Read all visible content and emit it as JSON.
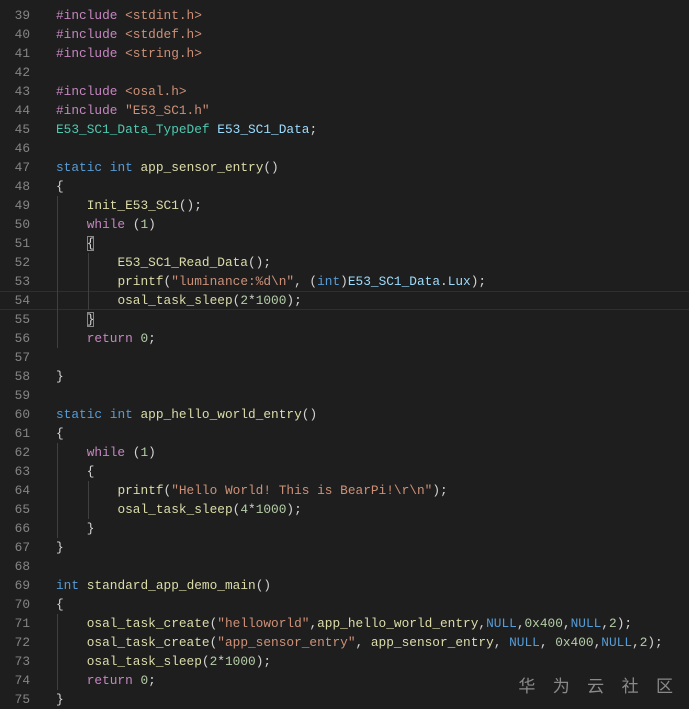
{
  "editor": {
    "current_line": 54,
    "colors": {
      "background": "#1e1e1e",
      "keyword": "#c586c0",
      "string": "#ce9178",
      "type": "#569cd6",
      "function": "#dcdcaa",
      "variable": "#9cdcfe",
      "class": "#4ec9b0",
      "number": "#b5cea8"
    },
    "lines": [
      {
        "n": "39",
        "tokens": [
          [
            "kw",
            "#include"
          ],
          [
            "plain",
            " "
          ],
          [
            "str",
            "<stdint.h>"
          ]
        ]
      },
      {
        "n": "40",
        "tokens": [
          [
            "kw",
            "#include"
          ],
          [
            "plain",
            " "
          ],
          [
            "str",
            "<stddef.h>"
          ]
        ]
      },
      {
        "n": "41",
        "tokens": [
          [
            "kw",
            "#include"
          ],
          [
            "plain",
            " "
          ],
          [
            "str",
            "<string.h>"
          ]
        ]
      },
      {
        "n": "42",
        "tokens": []
      },
      {
        "n": "43",
        "tokens": [
          [
            "kw",
            "#include"
          ],
          [
            "plain",
            " "
          ],
          [
            "str",
            "<osal.h>"
          ]
        ]
      },
      {
        "n": "44",
        "tokens": [
          [
            "kw",
            "#include"
          ],
          [
            "plain",
            " "
          ],
          [
            "str",
            "\"E53_SC1.h\""
          ]
        ]
      },
      {
        "n": "45",
        "tokens": [
          [
            "cls",
            "E53_SC1_Data_TypeDef"
          ],
          [
            "plain",
            " "
          ],
          [
            "var",
            "E53_SC1_Data"
          ],
          [
            "plain",
            ";"
          ]
        ]
      },
      {
        "n": "46",
        "tokens": []
      },
      {
        "n": "47",
        "tokens": [
          [
            "type",
            "static"
          ],
          [
            "plain",
            " "
          ],
          [
            "type",
            "int"
          ],
          [
            "plain",
            " "
          ],
          [
            "fn",
            "app_sensor_entry"
          ],
          [
            "plain",
            "()"
          ]
        ]
      },
      {
        "n": "48",
        "tokens": [
          [
            "plain",
            "{"
          ]
        ]
      },
      {
        "n": "49",
        "tokens": [
          [
            "plain",
            "    "
          ],
          [
            "fn",
            "Init_E53_SC1"
          ],
          [
            "plain",
            "();"
          ]
        ]
      },
      {
        "n": "50",
        "tokens": [
          [
            "plain",
            "    "
          ],
          [
            "kw",
            "while"
          ],
          [
            "plain",
            " ("
          ],
          [
            "num",
            "1"
          ],
          [
            "plain",
            ")"
          ]
        ]
      },
      {
        "n": "51",
        "tokens": [
          [
            "plain",
            "    "
          ],
          [
            "br",
            "{"
          ]
        ]
      },
      {
        "n": "52",
        "tokens": [
          [
            "plain",
            "        "
          ],
          [
            "fn",
            "E53_SC1_Read_Data"
          ],
          [
            "plain",
            "();"
          ]
        ]
      },
      {
        "n": "53",
        "tokens": [
          [
            "plain",
            "        "
          ],
          [
            "fn",
            "printf"
          ],
          [
            "plain",
            "("
          ],
          [
            "str",
            "\"luminance:%d\\n\""
          ],
          [
            "plain",
            ", ("
          ],
          [
            "type",
            "int"
          ],
          [
            "plain",
            ")"
          ],
          [
            "var",
            "E53_SC1_Data"
          ],
          [
            "plain",
            "."
          ],
          [
            "var",
            "Lux"
          ],
          [
            "plain",
            ");"
          ]
        ]
      },
      {
        "n": "54",
        "tokens": [
          [
            "plain",
            "        "
          ],
          [
            "fn",
            "osal_task_sleep"
          ],
          [
            "plain",
            "("
          ],
          [
            "num",
            "2"
          ],
          [
            "plain",
            "*"
          ],
          [
            "num",
            "1000"
          ],
          [
            "plain",
            ");"
          ]
        ]
      },
      {
        "n": "55",
        "tokens": [
          [
            "plain",
            "    "
          ],
          [
            "br",
            "}"
          ]
        ]
      },
      {
        "n": "56",
        "tokens": [
          [
            "plain",
            "    "
          ],
          [
            "kw",
            "return"
          ],
          [
            "plain",
            " "
          ],
          [
            "num",
            "0"
          ],
          [
            "plain",
            ";"
          ]
        ]
      },
      {
        "n": "57",
        "tokens": []
      },
      {
        "n": "58",
        "tokens": [
          [
            "plain",
            "}"
          ]
        ]
      },
      {
        "n": "59",
        "tokens": []
      },
      {
        "n": "60",
        "tokens": [
          [
            "type",
            "static"
          ],
          [
            "plain",
            " "
          ],
          [
            "type",
            "int"
          ],
          [
            "plain",
            " "
          ],
          [
            "fn",
            "app_hello_world_entry"
          ],
          [
            "plain",
            "()"
          ]
        ]
      },
      {
        "n": "61",
        "tokens": [
          [
            "plain",
            "{"
          ]
        ]
      },
      {
        "n": "62",
        "tokens": [
          [
            "plain",
            "    "
          ],
          [
            "kw",
            "while"
          ],
          [
            "plain",
            " ("
          ],
          [
            "num",
            "1"
          ],
          [
            "plain",
            ")"
          ]
        ]
      },
      {
        "n": "63",
        "tokens": [
          [
            "plain",
            "    {"
          ]
        ]
      },
      {
        "n": "64",
        "tokens": [
          [
            "plain",
            "        "
          ],
          [
            "fn",
            "printf"
          ],
          [
            "plain",
            "("
          ],
          [
            "str",
            "\"Hello World! This is BearPi!\\r\\n\""
          ],
          [
            "plain",
            ");"
          ]
        ]
      },
      {
        "n": "65",
        "tokens": [
          [
            "plain",
            "        "
          ],
          [
            "fn",
            "osal_task_sleep"
          ],
          [
            "plain",
            "("
          ],
          [
            "num",
            "4"
          ],
          [
            "plain",
            "*"
          ],
          [
            "num",
            "1000"
          ],
          [
            "plain",
            ");"
          ]
        ]
      },
      {
        "n": "66",
        "tokens": [
          [
            "plain",
            "    }"
          ]
        ]
      },
      {
        "n": "67",
        "tokens": [
          [
            "plain",
            "}"
          ]
        ]
      },
      {
        "n": "68",
        "tokens": []
      },
      {
        "n": "69",
        "tokens": [
          [
            "type",
            "int"
          ],
          [
            "plain",
            " "
          ],
          [
            "fn",
            "standard_app_demo_main"
          ],
          [
            "plain",
            "()"
          ]
        ]
      },
      {
        "n": "70",
        "tokens": [
          [
            "plain",
            "{"
          ]
        ]
      },
      {
        "n": "71",
        "tokens": [
          [
            "plain",
            "    "
          ],
          [
            "fn",
            "osal_task_create"
          ],
          [
            "plain",
            "("
          ],
          [
            "str",
            "\"helloworld\""
          ],
          [
            "plain",
            ","
          ],
          [
            "fn",
            "app_hello_world_entry"
          ],
          [
            "plain",
            ","
          ],
          [
            "const",
            "NULL"
          ],
          [
            "plain",
            ","
          ],
          [
            "num",
            "0x400"
          ],
          [
            "plain",
            ","
          ],
          [
            "const",
            "NULL"
          ],
          [
            "plain",
            ","
          ],
          [
            "num",
            "2"
          ],
          [
            "plain",
            ");"
          ]
        ]
      },
      {
        "n": "72",
        "tokens": [
          [
            "plain",
            "    "
          ],
          [
            "fn",
            "osal_task_create"
          ],
          [
            "plain",
            "("
          ],
          [
            "str",
            "\"app_sensor_entry\""
          ],
          [
            "plain",
            ", "
          ],
          [
            "fn",
            "app_sensor_entry"
          ],
          [
            "plain",
            ", "
          ],
          [
            "const",
            "NULL"
          ],
          [
            "plain",
            ", "
          ],
          [
            "num",
            "0x400"
          ],
          [
            "plain",
            ","
          ],
          [
            "const",
            "NULL"
          ],
          [
            "plain",
            ","
          ],
          [
            "num",
            "2"
          ],
          [
            "plain",
            ");"
          ]
        ]
      },
      {
        "n": "73",
        "tokens": [
          [
            "plain",
            "    "
          ],
          [
            "fn",
            "osal_task_sleep"
          ],
          [
            "plain",
            "("
          ],
          [
            "num",
            "2"
          ],
          [
            "plain",
            "*"
          ],
          [
            "num",
            "1000"
          ],
          [
            "plain",
            ");"
          ]
        ]
      },
      {
        "n": "74",
        "tokens": [
          [
            "plain",
            "    "
          ],
          [
            "kw",
            "return"
          ],
          [
            "plain",
            " "
          ],
          [
            "num",
            "0"
          ],
          [
            "plain",
            ";"
          ]
        ]
      },
      {
        "n": "75",
        "tokens": [
          [
            "plain",
            "}"
          ]
        ]
      }
    ]
  },
  "watermark": "华 为 云 社 区"
}
